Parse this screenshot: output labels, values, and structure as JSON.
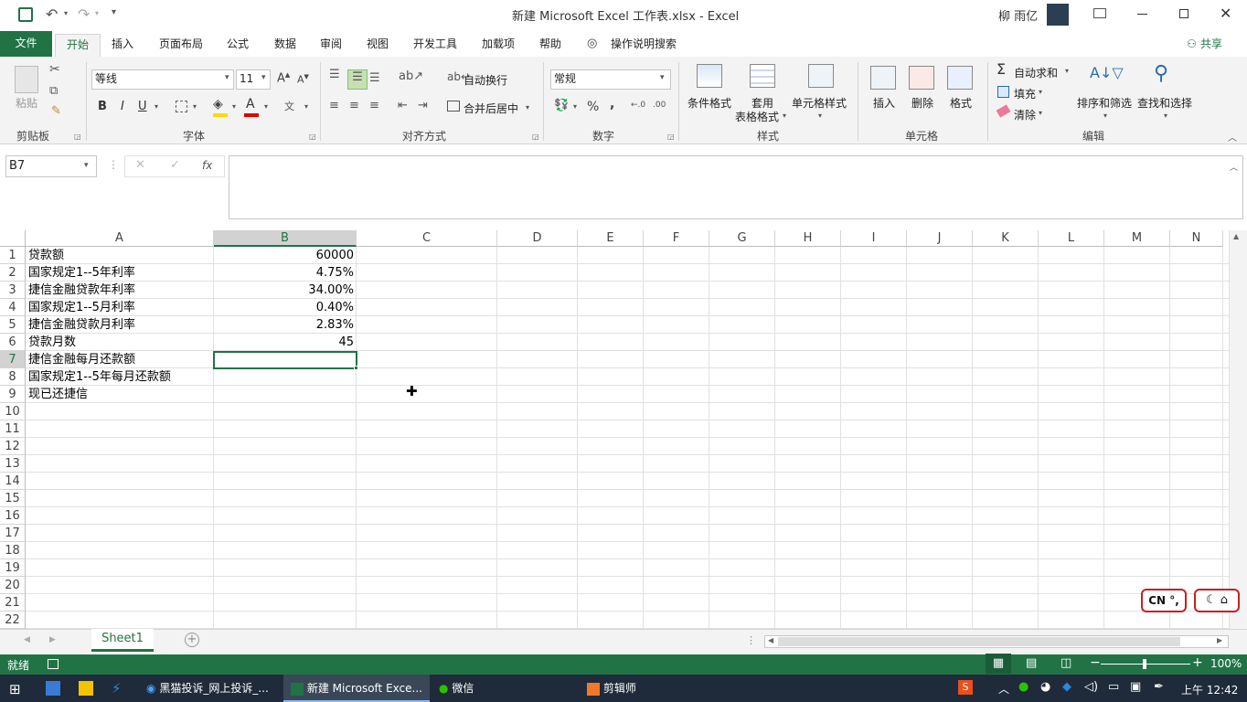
{
  "window": {
    "title": "新建 Microsoft Excel 工作表.xlsx  -  Excel",
    "user": "柳 雨亿"
  },
  "menu": {
    "file": "文件",
    "tabs": [
      "开始",
      "插入",
      "页面布局",
      "公式",
      "数据",
      "审阅",
      "视图",
      "开发工具",
      "加载项",
      "帮助"
    ],
    "tell_me": "操作说明搜索",
    "share": "共享"
  },
  "ribbon": {
    "clipboard": {
      "paste": "粘贴",
      "label": "剪贴板"
    },
    "font": {
      "name": "等线",
      "size": "11",
      "bold": "B",
      "italic": "I",
      "underline": "U",
      "label": "字体"
    },
    "alignment": {
      "wrap": "自动换行",
      "merge": "合并后居中",
      "label": "对齐方式"
    },
    "number": {
      "format": "常规",
      "percent": "%",
      "comma": ",",
      "label": "数字"
    },
    "styles": {
      "conditional": "条件格式",
      "table1": "套用",
      "table2": "表格格式",
      "cell_styles": "单元格样式",
      "label": "样式"
    },
    "cells": {
      "insert": "插入",
      "delete": "删除",
      "format": "格式",
      "label": "单元格"
    },
    "editing": {
      "autosum": "自动求和",
      "fill": "填充",
      "clear": "清除",
      "sort": "排序和筛选",
      "find": "查找和选择",
      "label": "编辑"
    }
  },
  "formula_bar": {
    "name_box": "B7",
    "fx": "fx",
    "value": ""
  },
  "columns": [
    "A",
    "B",
    "C",
    "D",
    "E",
    "F",
    "G",
    "H",
    "I",
    "J",
    "K",
    "L",
    "M",
    "N"
  ],
  "rows": [
    "1",
    "2",
    "3",
    "4",
    "5",
    "6",
    "7",
    "8",
    "9",
    "10",
    "11",
    "12",
    "13",
    "14",
    "15",
    "16",
    "17",
    "18",
    "19",
    "20",
    "21",
    "22"
  ],
  "cells": {
    "A": [
      "贷款额",
      "国家规定1--5年利率",
      "捷信金融贷款年利率",
      "国家规定1--5月利率",
      "捷信金融贷款月利率",
      "贷款月数",
      "捷信金融每月还款额",
      "国家规定1--5年每月还款额",
      "现已还捷信"
    ],
    "B": [
      "60000",
      "4.75%",
      "34.00%",
      "0.40%",
      "2.83%",
      "45",
      "",
      "",
      ""
    ]
  },
  "selected_cell": "B7",
  "sheet_tabs": [
    "Sheet1"
  ],
  "status": {
    "ready": "就绪",
    "zoom": "100%"
  },
  "ime": {
    "label": "CN °,"
  },
  "taskbar": {
    "items": [
      "黑猫投诉_网上投诉_...",
      "新建 Microsoft Exce...",
      "微信",
      "剪辑师"
    ],
    "time": "上午 12:42"
  },
  "colors": {
    "excel_green": "#217346",
    "taskbar": "#1f2b3a"
  }
}
